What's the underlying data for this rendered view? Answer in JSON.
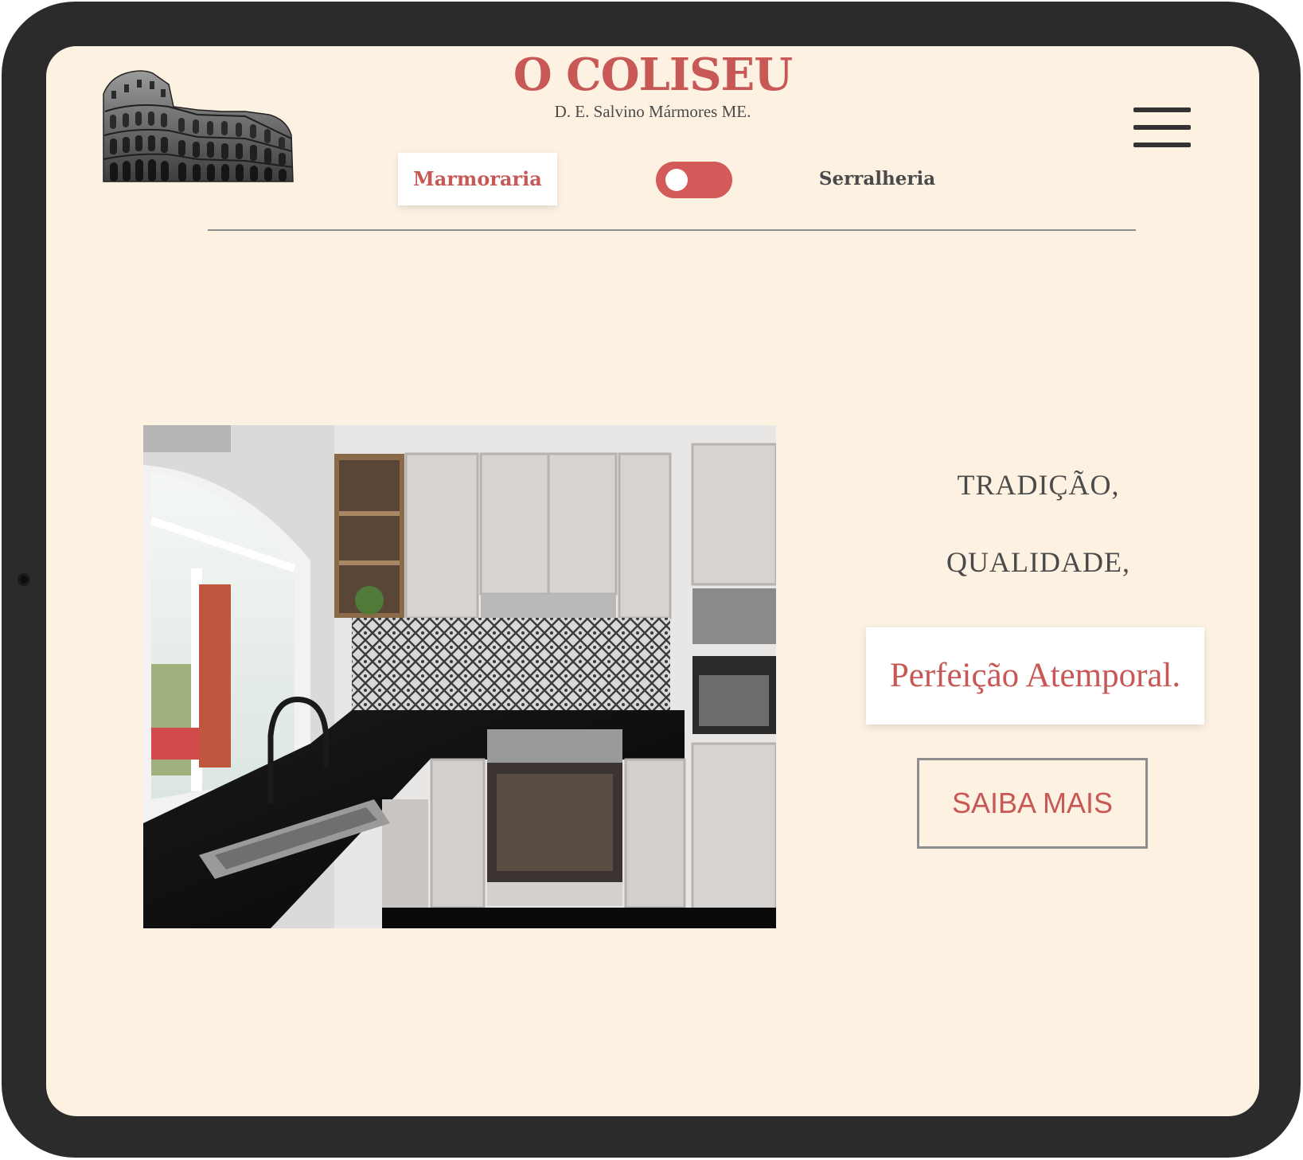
{
  "header": {
    "brand_name": "O COLISEU",
    "brand_subtitle": "D. E. Salvino Mármores ME.",
    "menu_icon": "hamburger-menu-icon",
    "logo_icon": "colosseum-logo"
  },
  "nav": {
    "tab_active_label": "Marmoraria",
    "tab_inactive_label": "Serralheria",
    "toggle_state": "on"
  },
  "hero": {
    "image_description_icon": "kitchen-photo",
    "tagline_1": "TRADIÇÃO,",
    "tagline_2": "QUALIDADE,",
    "tagline_highlight": "Perfeição Atemporal.",
    "cta_label": "SAIBA MAIS"
  },
  "colors": {
    "accent": "#c75855",
    "background": "#fdf2e2",
    "text": "#4a4a4a",
    "toggle": "#d25a58",
    "device_frame": "#2b2b2b"
  }
}
